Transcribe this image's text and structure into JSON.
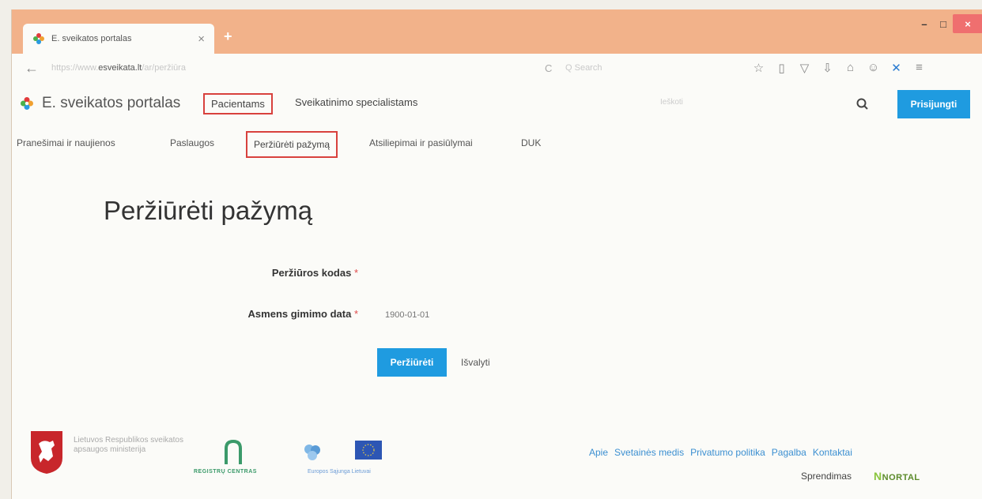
{
  "browser": {
    "tab_title": "E. sveikatos portalas",
    "tab_close": "×",
    "new_tab": "+",
    "win_min": "–",
    "win_max": "□",
    "win_close": "×",
    "url_prefix": "https://www.",
    "url_domain": "esveikata.lt",
    "url_path": "/ar/peržiūra",
    "search_placeholder": "Q Search",
    "accent": "#f2b28a"
  },
  "header": {
    "brand": "E. sveikatos portalas",
    "nav": [
      "Pacientams",
      "Sveikatinimo specialistams"
    ],
    "search_placeholder": "Ieškoti",
    "login": "Prisijungti"
  },
  "subnav": [
    "Pranešimai ir naujienos",
    "Paslaugos",
    "Peržiūrėti pažymą",
    "Atsiliepimai ir pasiūlymai",
    "DUK"
  ],
  "main": {
    "title": "Peržiūrėti pažymą",
    "code_label": "Peržiūros kodas",
    "birth_label": "Asmens gimimo data",
    "required_mark": "*",
    "birth_placeholder": "1900-01-01",
    "view_button": "Peržiūrėti",
    "clear_button": "Išvalyti"
  },
  "footer": {
    "ministry": "Lietuvos Respublikos sveikatos apsaugos ministerija",
    "registry": "REGISTRŲ CENTRAS",
    "eu_text": "Europos Sąjunga Lietuvai",
    "links": [
      "Apie",
      "Svetainės medis",
      "Privatumo politika",
      "Pagalba",
      "Kontaktai"
    ],
    "solution_label": "Sprendimas",
    "nortal": "NORTAL"
  },
  "colors": {
    "primary": "#1f9be0",
    "highlight": "#d8413d",
    "link": "#3b8fd1"
  }
}
